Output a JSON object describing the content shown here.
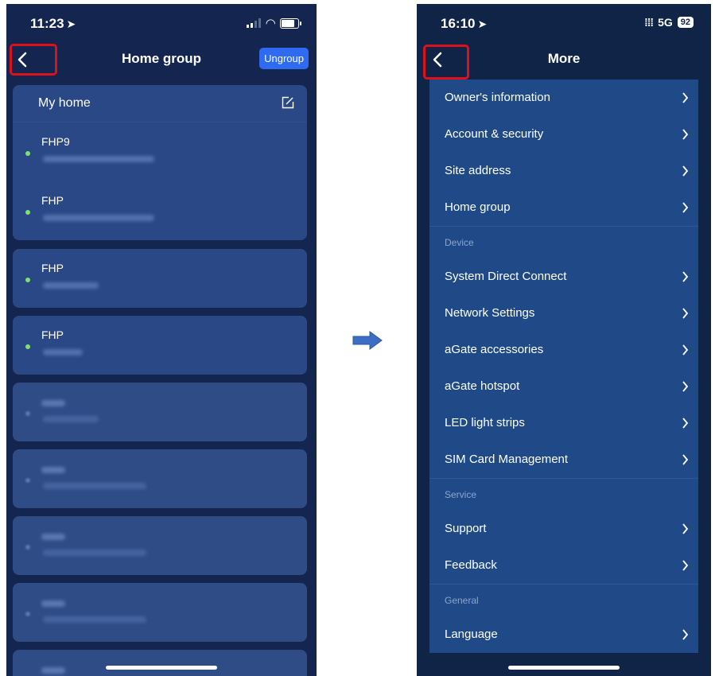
{
  "left_screen": {
    "status_time": "11:23",
    "nav_title": "Home group",
    "ungroup_label": "Ungroup",
    "home_card": {
      "title": "My home",
      "devices": [
        {
          "name": "FHP9",
          "online": true
        },
        {
          "name": "FHP",
          "online": true
        }
      ]
    },
    "device_cards": [
      {
        "name": "FHP",
        "online": true
      },
      {
        "name": "FHP",
        "online": true
      }
    ]
  },
  "right_screen": {
    "status_time": "16:10",
    "network": "5G",
    "battery": "92",
    "nav_title": "More",
    "groups": [
      {
        "header": "",
        "items": [
          "Owner's information",
          "Account & security",
          "Site address",
          "Home group"
        ]
      },
      {
        "header": "Device",
        "items": [
          "System Direct Connect",
          "Network Settings",
          "aGate accessories",
          "aGate hotspot",
          "LED light strips",
          "SIM Card Management"
        ]
      },
      {
        "header": "Service",
        "items": [
          "Support",
          "Feedback"
        ]
      },
      {
        "header": "General",
        "items": [
          "Language"
        ]
      }
    ]
  },
  "colors": {
    "highlight": "#e0101a",
    "arrow": "#3c6fc4",
    "online_dot": "#7ee26c",
    "ungroup_button": "#2f6bf0"
  },
  "icons": {
    "back": "chevron-left-icon",
    "item": "chevron-right-icon",
    "edit": "edit-icon",
    "transition": "right-arrow-icon"
  }
}
